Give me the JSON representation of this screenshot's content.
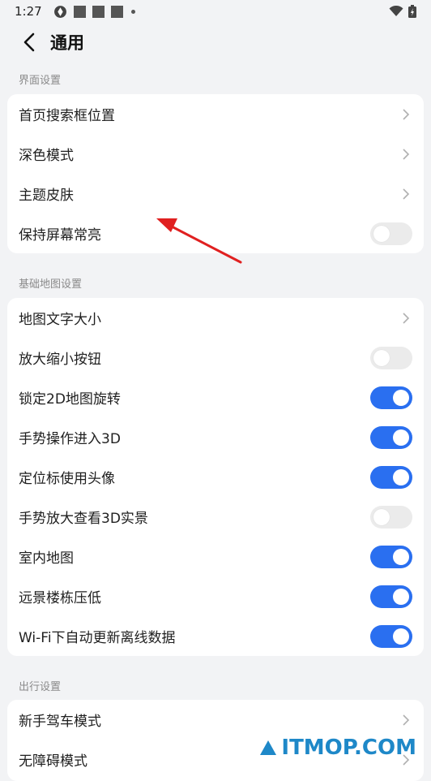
{
  "status_bar": {
    "time": "1:27"
  },
  "header": {
    "title": "通用"
  },
  "sections": [
    {
      "label": "界面设置",
      "items": [
        {
          "label": "首页搜索框位置",
          "type": "chevron"
        },
        {
          "label": "深色模式",
          "type": "chevron"
        },
        {
          "label": "主题皮肤",
          "type": "chevron"
        },
        {
          "label": "保持屏幕常亮",
          "type": "toggle",
          "on": false
        }
      ]
    },
    {
      "label": "基础地图设置",
      "items": [
        {
          "label": "地图文字大小",
          "type": "chevron"
        },
        {
          "label": "放大缩小按钮",
          "type": "toggle",
          "on": false
        },
        {
          "label": "锁定2D地图旋转",
          "type": "toggle",
          "on": true
        },
        {
          "label": "手势操作进入3D",
          "type": "toggle",
          "on": true
        },
        {
          "label": "定位标使用头像",
          "type": "toggle",
          "on": true
        },
        {
          "label": "手势放大查看3D实景",
          "type": "toggle",
          "on": false
        },
        {
          "label": "室内地图",
          "type": "toggle",
          "on": true
        },
        {
          "label": "远景楼栋压低",
          "type": "toggle",
          "on": true
        },
        {
          "label": "Wi-Fi下自动更新离线数据",
          "type": "toggle",
          "on": true
        }
      ]
    },
    {
      "label": "出行设置",
      "items": [
        {
          "label": "新手驾车模式",
          "type": "chevron"
        },
        {
          "label": "无障碍模式",
          "type": "chevron"
        }
      ]
    }
  ],
  "watermark": {
    "text": "ITMOP.COM"
  },
  "colors": {
    "accent": "#2a6ff0",
    "toggle_off": "#ebebeb",
    "background": "#f2f3f5",
    "annotation_arrow": "#e02020",
    "watermark": "#1e88c8"
  }
}
